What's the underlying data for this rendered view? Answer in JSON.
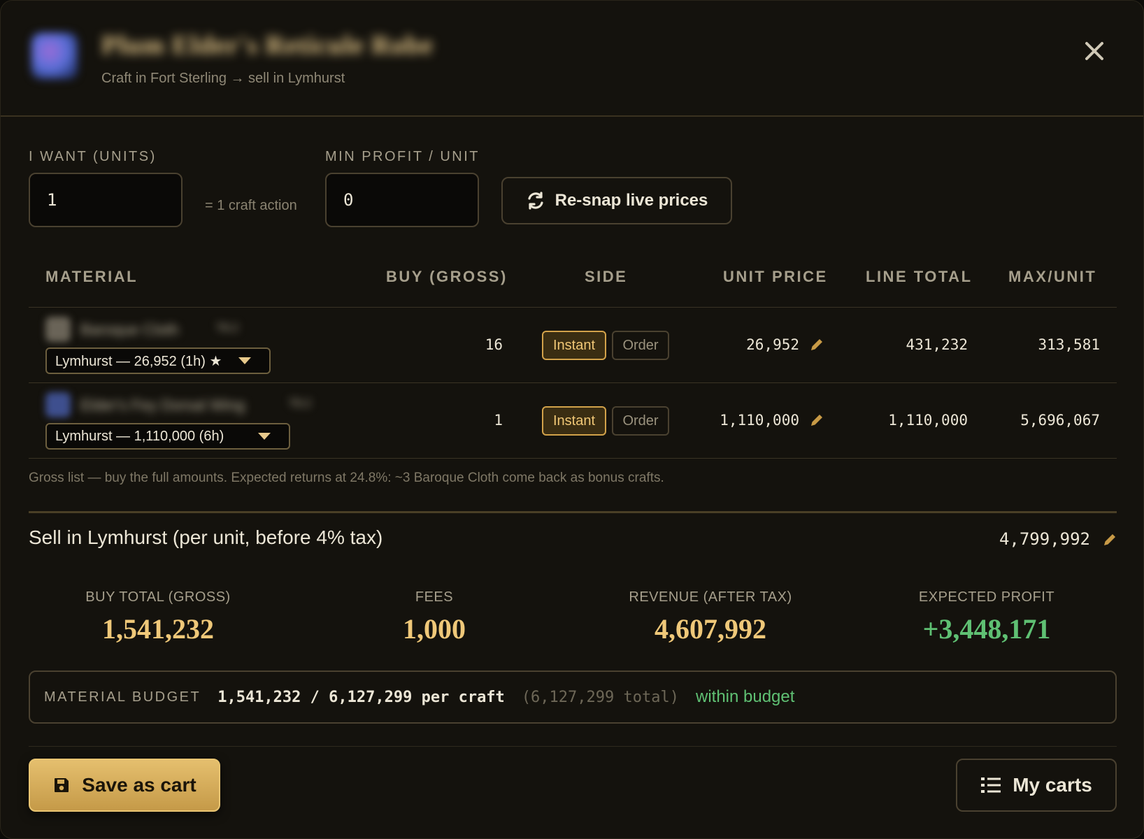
{
  "header": {
    "item_title": "Plum Elder's Reticule Robe",
    "subtitle": "Craft in Fort Sterling → sell in Lymhurst",
    "close_label": "✕"
  },
  "controls": {
    "units_label": "I WANT (UNITS)",
    "units_value": "1",
    "craft_note": "= 1 craft action",
    "min_profit_label": "MIN PROFIT / UNIT",
    "min_profit_value": "0",
    "resnap_label": "Re-snap live prices"
  },
  "table": {
    "columns": [
      "MATERIAL",
      "BUY (GROSS)",
      "SIDE",
      "UNIT PRICE",
      "LINE TOTAL",
      "MAX/UNIT"
    ],
    "rows": [
      {
        "material_name": "Baroque Cloth",
        "material_tier": "T8.2",
        "source": "Lymhurst — 26,952 (1h) ★",
        "buy": "16",
        "side_instant": "Instant",
        "side_order": "Order",
        "selected_side": "Instant",
        "unit_price": "26,952",
        "line_total": "431,232",
        "max_unit": "313,581"
      },
      {
        "material_name": "Elder's Fey Dorsal Wing",
        "material_tier": "T8.2",
        "source": "Lymhurst — 1,110,000 (6h)",
        "buy": "1",
        "side_instant": "Instant",
        "side_order": "Order",
        "selected_side": "Instant",
        "unit_price": "1,110,000",
        "line_total": "1,110,000",
        "max_unit": "5,696,067"
      }
    ],
    "note": "Gross list — buy the full amounts. Expected returns at 24.8%: ~3 Baroque Cloth come back as bonus crafts."
  },
  "sell": {
    "label": "Sell in Lymhurst (per unit, before 4% tax)",
    "value": "4,799,992"
  },
  "stats": [
    {
      "label": "BUY TOTAL (GROSS)",
      "value": "1,541,232"
    },
    {
      "label": "FEES",
      "value": "1,000"
    },
    {
      "label": "REVENUE (AFTER TAX)",
      "value": "4,607,992"
    },
    {
      "label": "EXPECTED PROFIT",
      "value": "+3,448,171"
    }
  ],
  "budget": {
    "label": "MATERIAL BUDGET",
    "main": "1,541,232 / 6,127,299 per craft",
    "total": "(6,127,299 total)",
    "status": "within budget"
  },
  "footer": {
    "save_label": "Save as cart",
    "carts_label": "My carts"
  },
  "colors": {
    "accent_gold": "#efc879",
    "profit_green": "#5fc073",
    "background": "#14120d"
  },
  "icons": [
    "close-icon",
    "refresh-icon",
    "pencil-icon",
    "chevron-down-icon",
    "save-icon",
    "list-icon"
  ]
}
